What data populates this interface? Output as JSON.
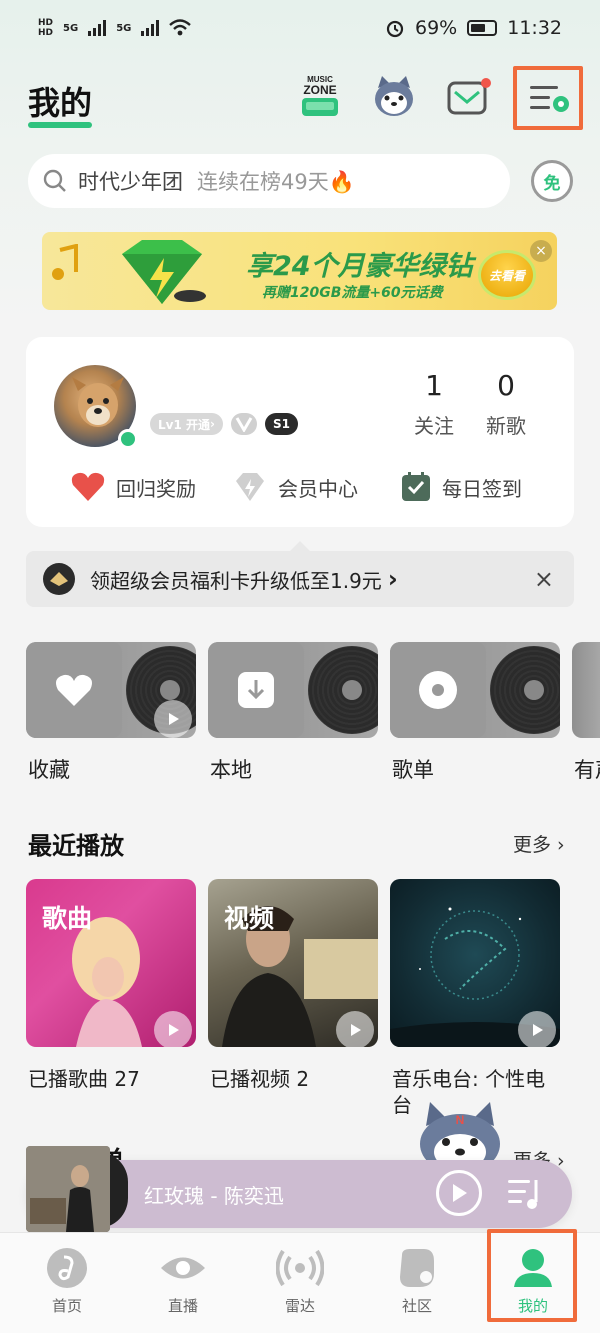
{
  "status_bar": {
    "battery": "69%",
    "time": "11:32",
    "net1": "5G",
    "net2": "5G"
  },
  "header": {
    "title": "我的",
    "music_zone_label": "MUSIC ZONE"
  },
  "search": {
    "query": "时代少年团",
    "hint": "连续在榜49天🔥",
    "free_label": "免"
  },
  "banner": {
    "headline": "享24个月豪华绿钻",
    "subline": "再赠120GB流量+60元话费",
    "button": "去看看",
    "close": "×"
  },
  "profile": {
    "badge_level": "Lv1 开通",
    "badge_s": "S1",
    "following_count": "1",
    "following_label": "关注",
    "new_songs_count": "0",
    "new_songs_label": "新歌",
    "quick_actions": [
      {
        "label": "回归奖励",
        "icon": "heart-icon"
      },
      {
        "label": "会员中心",
        "icon": "diamond-icon"
      },
      {
        "label": "每日签到",
        "icon": "calendar-check-icon"
      }
    ]
  },
  "promo": {
    "text": "领超级会员福利卡升级低至1.9元",
    "chevron": "›",
    "close": "×"
  },
  "library_tiles": [
    {
      "label": "收藏",
      "icon": "heart-icon"
    },
    {
      "label": "本地",
      "icon": "download-icon"
    },
    {
      "label": "歌单",
      "icon": "disc-icon"
    },
    {
      "label": "有声"
    }
  ],
  "recent": {
    "title": "最近播放",
    "more": "更多 ›",
    "items": [
      {
        "tag": "歌曲",
        "label": "已播歌曲 27"
      },
      {
        "tag": "视频",
        "label": "已播视频 2"
      },
      {
        "tag": "",
        "label": "音乐电台: 个性电台"
      }
    ]
  },
  "section2": {
    "title": "自建歌单",
    "more": "更多 ›"
  },
  "player": {
    "song": "红玫瑰 - 陈奕迅"
  },
  "tabbar": {
    "tabs": [
      {
        "label": "首页"
      },
      {
        "label": "直播"
      },
      {
        "label": "雷达"
      },
      {
        "label": "社区"
      },
      {
        "label": "我的"
      }
    ]
  },
  "colors": {
    "accent": "#2fc27e",
    "highlight": "#f06b3b"
  }
}
